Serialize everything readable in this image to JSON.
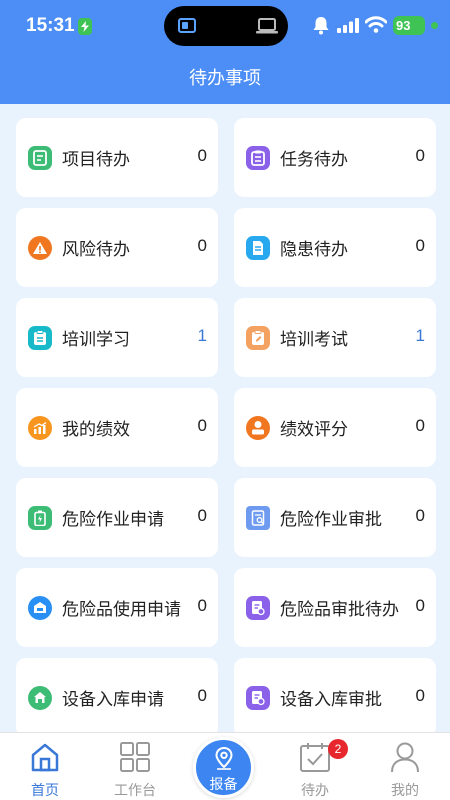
{
  "status_bar": {
    "time": "15:31",
    "battery": "93"
  },
  "header": {
    "title": "待办事项"
  },
  "cards": [
    {
      "label": "项目待办",
      "count": "0",
      "icon": "project-icon",
      "color": "#3dbc76"
    },
    {
      "label": "任务待办",
      "count": "0",
      "icon": "task-icon",
      "color": "#8a61e8"
    },
    {
      "label": "风险待办",
      "count": "0",
      "icon": "warning-icon",
      "color": "#f0761f"
    },
    {
      "label": "隐患待办",
      "count": "0",
      "icon": "hazard-icon",
      "color": "#28a8ef"
    },
    {
      "label": "培训学习",
      "count": "1",
      "icon": "training-icon",
      "color": "#18b9c9"
    },
    {
      "label": "培训考试",
      "count": "1",
      "icon": "exam-icon",
      "color": "#f4a261"
    },
    {
      "label": "我的绩效",
      "count": "0",
      "icon": "chart-icon",
      "color": "#f7951f"
    },
    {
      "label": "绩效评分",
      "count": "0",
      "icon": "user-score-icon",
      "color": "#f0761f"
    },
    {
      "label": "危险作业申请",
      "count": "0",
      "icon": "battery-apply-icon",
      "color": "#3dbc76"
    },
    {
      "label": "危险作业审批",
      "count": "0",
      "icon": "document-approve-icon",
      "color": "#6e9bf0"
    },
    {
      "label": "危险品使用申请",
      "count": "0",
      "icon": "box-icon",
      "color": "#2a8ff5"
    },
    {
      "label": "危险品审批待办",
      "count": "0",
      "icon": "form-approve-icon",
      "color": "#8a61e8"
    },
    {
      "label": "设备入库申请",
      "count": "0",
      "icon": "home-box-icon",
      "color": "#3dbc76"
    },
    {
      "label": "设备入库审批",
      "count": "0",
      "icon": "equipment-approve-icon",
      "color": "#8a61e8"
    }
  ],
  "tabbar": {
    "home": "首页",
    "workbench": "工作台",
    "report": "报备",
    "todo": "待办",
    "todo_badge": "2",
    "mine": "我的"
  },
  "colors": {
    "header": "#4c8ef5",
    "accent": "#3a78d8",
    "background": "#e9f3fe",
    "badge": "#e7272d"
  }
}
